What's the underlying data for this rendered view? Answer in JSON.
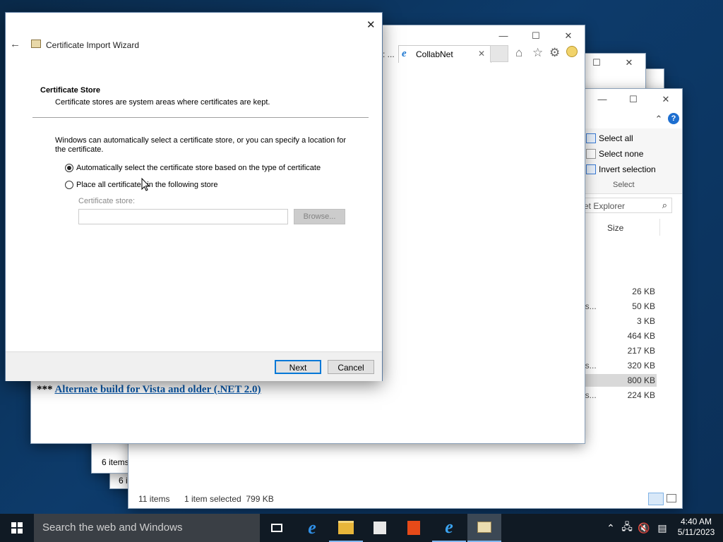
{
  "explorer": {
    "status_back": "6 items",
    "status_back2": "6 i",
    "ribbon": {
      "select_all": "Select all",
      "select_none": "Select none",
      "invert_selection": "Invert selection",
      "group_label": "Select"
    },
    "search_placeholder": "et Explorer",
    "size_header": "Size",
    "rows": [
      {
        "type": "",
        "size": "26 KB"
      },
      {
        "type": "ns...",
        "size": "50 KB"
      },
      {
        "type": "",
        "size": "3 KB"
      },
      {
        "type": "",
        "size": "464 KB"
      },
      {
        "type": "",
        "size": "217 KB"
      },
      {
        "type": "ns...",
        "size": "320 KB"
      },
      {
        "type": "",
        "size": "800 KB"
      },
      {
        "type": "ns...",
        "size": "224 KB"
      }
    ],
    "status_items": "11 items",
    "status_selected": "1 item selected  799 KB"
  },
  "ie": {
    "prev_tab": ": ...",
    "tab_title": "CollabNet",
    "link_prefix": "***",
    "link_text": "Alternate build for Vista and older (.NET 2.0)"
  },
  "wizard": {
    "title": "Certificate Import Wizard",
    "heading": "Certificate Store",
    "subheading": "Certificate stores are system areas where certificates are kept.",
    "description": "Windows can automatically select a certificate store, or you can specify a location for the certificate.",
    "option_auto": "Automatically select the certificate store based on the type of certificate",
    "option_manual": "Place all certificates in the following store",
    "store_label": "Certificate store:",
    "store_value": "",
    "browse_label": "Browse...",
    "next_label": "Next",
    "cancel_label": "Cancel"
  },
  "taskbar": {
    "search_placeholder": "Search the web and Windows",
    "time": "4:40 AM",
    "date": "5/11/2023"
  },
  "colors": {
    "accent": "#0078d7",
    "link": "#0a58a8",
    "taskbar": "#101a24"
  }
}
